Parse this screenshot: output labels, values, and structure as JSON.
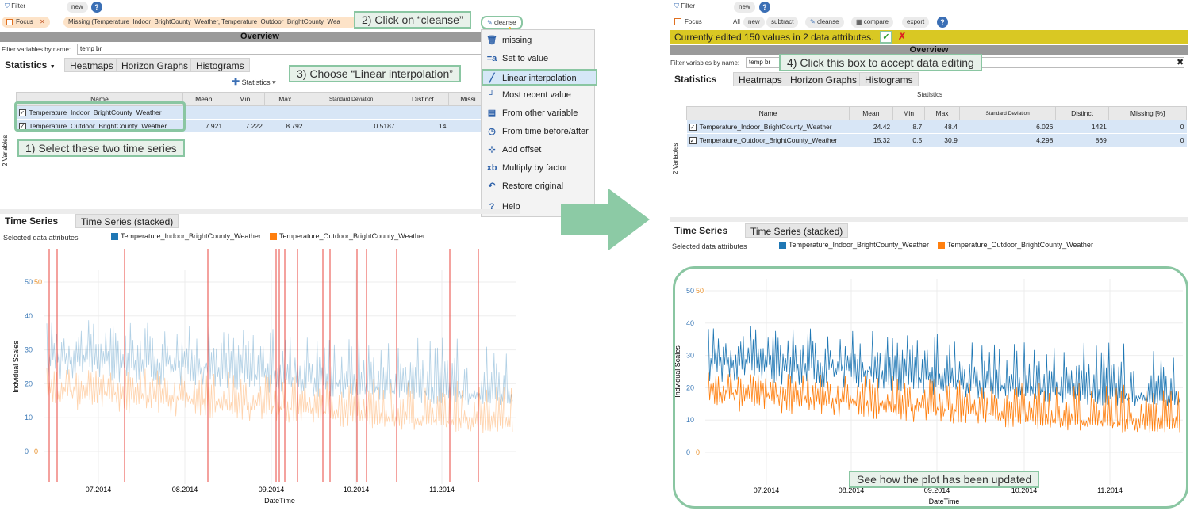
{
  "left": {
    "toolbar": {
      "filter_label": "Filter",
      "new_label": "new",
      "focus_label": "Focus",
      "missing_label": "Missing (Temperature_Indoor_BrightCounty_Weather, Temperature_Outdoor_BrightCounty_Wea",
      "cleanse_label": "cleanse"
    },
    "overview_label": "Overview",
    "filter_vars": {
      "label": "Filter variables by name:",
      "value": "temp br"
    },
    "tabs": [
      "Statistics",
      "Heatmaps",
      "Horizon Graphs",
      "Histograms"
    ],
    "stats_button": "Statistics",
    "side_label": "2 Variables",
    "table": {
      "headers": [
        "Name",
        "Mean",
        "Min",
        "Max",
        "Standard Deviation",
        "Distinct",
        "Missi"
      ],
      "rows": [
        [
          "Temperature_Indoor_BrightCounty_Weather",
          "",
          "",
          "",
          "",
          "",
          ""
        ],
        [
          "Temperature_Outdoor_BrightCounty_Weather",
          "7.921",
          "7.222",
          "8.792",
          "0.5187",
          "14",
          ""
        ]
      ]
    },
    "menu": [
      "missing",
      "Set to value",
      "Linear interpolation",
      "Most recent value",
      "From other variable",
      "From time before/after",
      "Add offset",
      "Multiply by factor",
      "Restore original",
      "Help"
    ],
    "ts_tabs": [
      "Time Series",
      "Time Series (stacked)"
    ],
    "selected_label": "Selected data attributes",
    "legend": [
      "Temperature_Indoor_BrightCounty_Weather",
      "Temperature_Outdoor_BrightCounty_Weather"
    ]
  },
  "right": {
    "toolbar": {
      "filter_label": "Filter",
      "new_label": "new",
      "focus_label": "Focus",
      "all_label": "All",
      "new2_label": "new",
      "subtract_label": "subtract",
      "cleanse_label": "cleanse",
      "compare_label": "compare",
      "export_label": "export"
    },
    "edit_banner": "Currently edited 150 values in 2 data attributes.",
    "overview_label": "Overview",
    "filter_vars": {
      "label": "Filter variables by name:",
      "value": "temp br"
    },
    "tabs": [
      "Statistics",
      "Heatmaps",
      "Horizon Graphs",
      "Histograms"
    ],
    "stats_title": "Statistics",
    "side_label": "2 Variables",
    "table": {
      "headers": [
        "Name",
        "Mean",
        "Min",
        "Max",
        "Standard Deviation",
        "Distinct",
        "Missing [%]"
      ],
      "rows": [
        [
          "Temperature_Indoor_BrightCounty_Weather",
          "24.42",
          "8.7",
          "48.4",
          "6.026",
          "1421",
          "0"
        ],
        [
          "Temperature_Outdoor_BrightCounty_Weather",
          "15.32",
          "0.5",
          "30.9",
          "4.298",
          "869",
          "0"
        ]
      ]
    },
    "ts_tabs": [
      "Time Series",
      "Time Series (stacked)"
    ],
    "selected_label": "Selected data attributes",
    "legend": [
      "Temperature_Indoor_BrightCounty_Weather",
      "Temperature_Outdoor_BrightCounty_Weather"
    ]
  },
  "callouts": {
    "step1": "1) Select these two time series",
    "step2": "2) Click on “cleanse”",
    "step3": "3) Choose “Linear interpolation”",
    "step4": "4) Click this box to accept data editing",
    "updated": "See how the plot has been updated"
  },
  "colors": {
    "indoor": "#1f77b4",
    "outdoor": "#ff7f0e",
    "missing_marker": "#e8453c",
    "accent": "#8ac6a2",
    "banner": "#d9c823",
    "arrow": "#8ccaa5"
  },
  "icons": {
    "filter": "funnel-icon",
    "help": "help-icon",
    "cleanse": "pencil-icon",
    "accept": "check-icon",
    "reject": "x-icon"
  },
  "chart_data": [
    {
      "type": "line",
      "title": "Time Series",
      "xlabel": "DateTime",
      "ylabel": "Indvidual Scales",
      "x_ticks": [
        "07.2014",
        "08.2014",
        "09.2014",
        "10.2014",
        "11.2014"
      ],
      "y_ticks_indoor": [
        0,
        10,
        20,
        30,
        40,
        50
      ],
      "y_ticks_outdoor": [
        0,
        50
      ],
      "series": [
        {
          "name": "Temperature_Indoor_BrightCounty_Weather",
          "approx_range": [
            8,
            48
          ],
          "approx_mean": 24
        },
        {
          "name": "Temperature_Outdoor_BrightCounty_Weather",
          "approx_range": [
            0,
            31
          ],
          "approx_mean": 15
        }
      ],
      "missing_markers": 15,
      "faded": true
    },
    {
      "type": "line",
      "title": "Time Series",
      "xlabel": "DateTime",
      "ylabel": "Indvidual Scales",
      "x_ticks": [
        "07.2014",
        "08.2014",
        "09.2014",
        "10.2014",
        "11.2014"
      ],
      "y_ticks_indoor": [
        0,
        10,
        20,
        30,
        40,
        50
      ],
      "y_ticks_outdoor": [
        0,
        50
      ],
      "series": [
        {
          "name": "Temperature_Indoor_BrightCounty_Weather",
          "approx_range": [
            8.7,
            48.4
          ],
          "approx_mean": 24.42
        },
        {
          "name": "Temperature_Outdoor_BrightCounty_Weather",
          "approx_range": [
            0.5,
            30.9
          ],
          "approx_mean": 15.32
        }
      ]
    }
  ]
}
